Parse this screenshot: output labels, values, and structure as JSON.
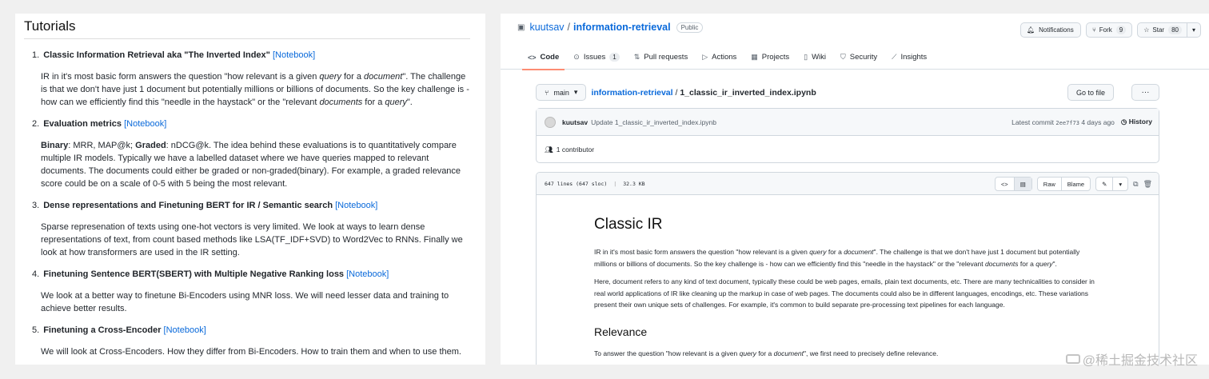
{
  "left": {
    "title": "Tutorials",
    "items": [
      {
        "num": "1.",
        "title": "Classic Information Retrieval aka \"The Inverted Index\"",
        "link": "[Notebook]",
        "desc_html": "IR in it's most basic form answers the question \"how relevant is a given <i>query</i> for a <i>document</i>\". The challenge is that we don't have just 1 document but potentially millions or billions of documents. So the key challenge is - how can we efficiently find this \"needle in the haystack\" or the \"relevant <i>documents</i> for a <i>query</i>\"."
      },
      {
        "num": "2.",
        "title": "Evaluation metrics",
        "link": "[Notebook]",
        "desc_html": "<b>Binary</b>: MRR, MAP@k; <b>Graded</b>: nDCG@k. The idea behind these evaluations is to quantitatively compare multiple IR models. Typically we have a labelled dataset where we have queries mapped to relevant documents. The documents could either be graded or non-graded(binary). For example, a graded relevance score could be on a scale of 0-5 with 5 being the most relevant."
      },
      {
        "num": "3.",
        "title": "Dense representations and Finetuning BERT for IR / Semantic search",
        "link": "[Notebook]",
        "desc_html": "Sparse represenation of texts using one-hot vectors is very limited. We look at ways to learn dense representations of text, from count based methods like LSA(TF_IDF+SVD) to Word2Vec to RNNs. Finally we look at how transformers are used in the IR setting."
      },
      {
        "num": "4.",
        "title": "Finetuning Sentence BERT(SBERT) with Multiple Negative Ranking loss",
        "link": "[Notebook]",
        "desc_html": "We look at a better way to finetune Bi-Encoders using MNR loss. We will need lesser data and training to achieve better results."
      },
      {
        "num": "5.",
        "title": "Finetuning a Cross-Encoder",
        "link": "[Notebook]",
        "desc_html": "We will look at Cross-Encoders. How they differ from Bi-Encoders. How to train them and when to use them."
      }
    ]
  },
  "repo": {
    "owner": "kuutsav",
    "name": "information-retrieval",
    "visibility": "Public",
    "notifications": "Notifications",
    "fork_label": "Fork",
    "fork_count": "9",
    "star_label": "Star",
    "star_count": "80"
  },
  "tabs": [
    {
      "icon": "<>",
      "label": "Code",
      "count": ""
    },
    {
      "icon": "⊙",
      "label": "Issues",
      "count": "1"
    },
    {
      "icon": "⇅",
      "label": "Pull requests",
      "count": ""
    },
    {
      "icon": "▷",
      "label": "Actions",
      "count": ""
    },
    {
      "icon": "▦",
      "label": "Projects",
      "count": ""
    },
    {
      "icon": "▯",
      "label": "Wiki",
      "count": ""
    },
    {
      "icon": "⛉",
      "label": "Security",
      "count": ""
    },
    {
      "icon": "⟋",
      "label": "Insights",
      "count": ""
    }
  ],
  "path": {
    "branch": "main",
    "repo_link": "information-retrieval",
    "file": "1_classic_ir_inverted_index.ipynb",
    "goto_file": "Go to file",
    "more": "···"
  },
  "commit": {
    "author": "kuutsav",
    "message": "Update 1_classic_ir_inverted_index.ipynb",
    "latest_label": "Latest commit",
    "sha": "2ee7f73",
    "age": "4 days ago",
    "history": "History",
    "contributors": "1 contributor"
  },
  "file": {
    "lines": "647 lines (647 sloc)",
    "size": "32.3 KB",
    "raw": "Raw",
    "blame": "Blame"
  },
  "notebook": {
    "title": "Classic IR",
    "p1_html": "IR in it's most basic form answers the question \"how relevant is a given <i>query</i> for a <i>document</i>\". The challenge is that we don't have just 1 document but potentially millions or billions of documents. So the key challenge is - how can we efficiently find this \"needle in the haystack\" or the \"relevant <i>documents</i> for a <i>query</i>\".",
    "p2": "Here, document refers to any kind of text document, typically these could be web pages, emails, plain text documents, etc. There are many technicalities to consider in real world applications of IR like cleaning up the markup in case of web pages. The documents could also be in different languages, encodings, etc. These variations present their own unique sets of challenges. For example, it's common to build separate pre-processing text pipelines for each language.",
    "h2": "Relevance",
    "p3_html": "To answer the question \"how relevant is a given <i>query</i> for a <i>document</i>\", we first need to precisely define relevance."
  },
  "watermark": "@稀土掘金技术社区",
  "colors": {
    "link": "#0969da",
    "active_tab": "#fd8c73"
  }
}
